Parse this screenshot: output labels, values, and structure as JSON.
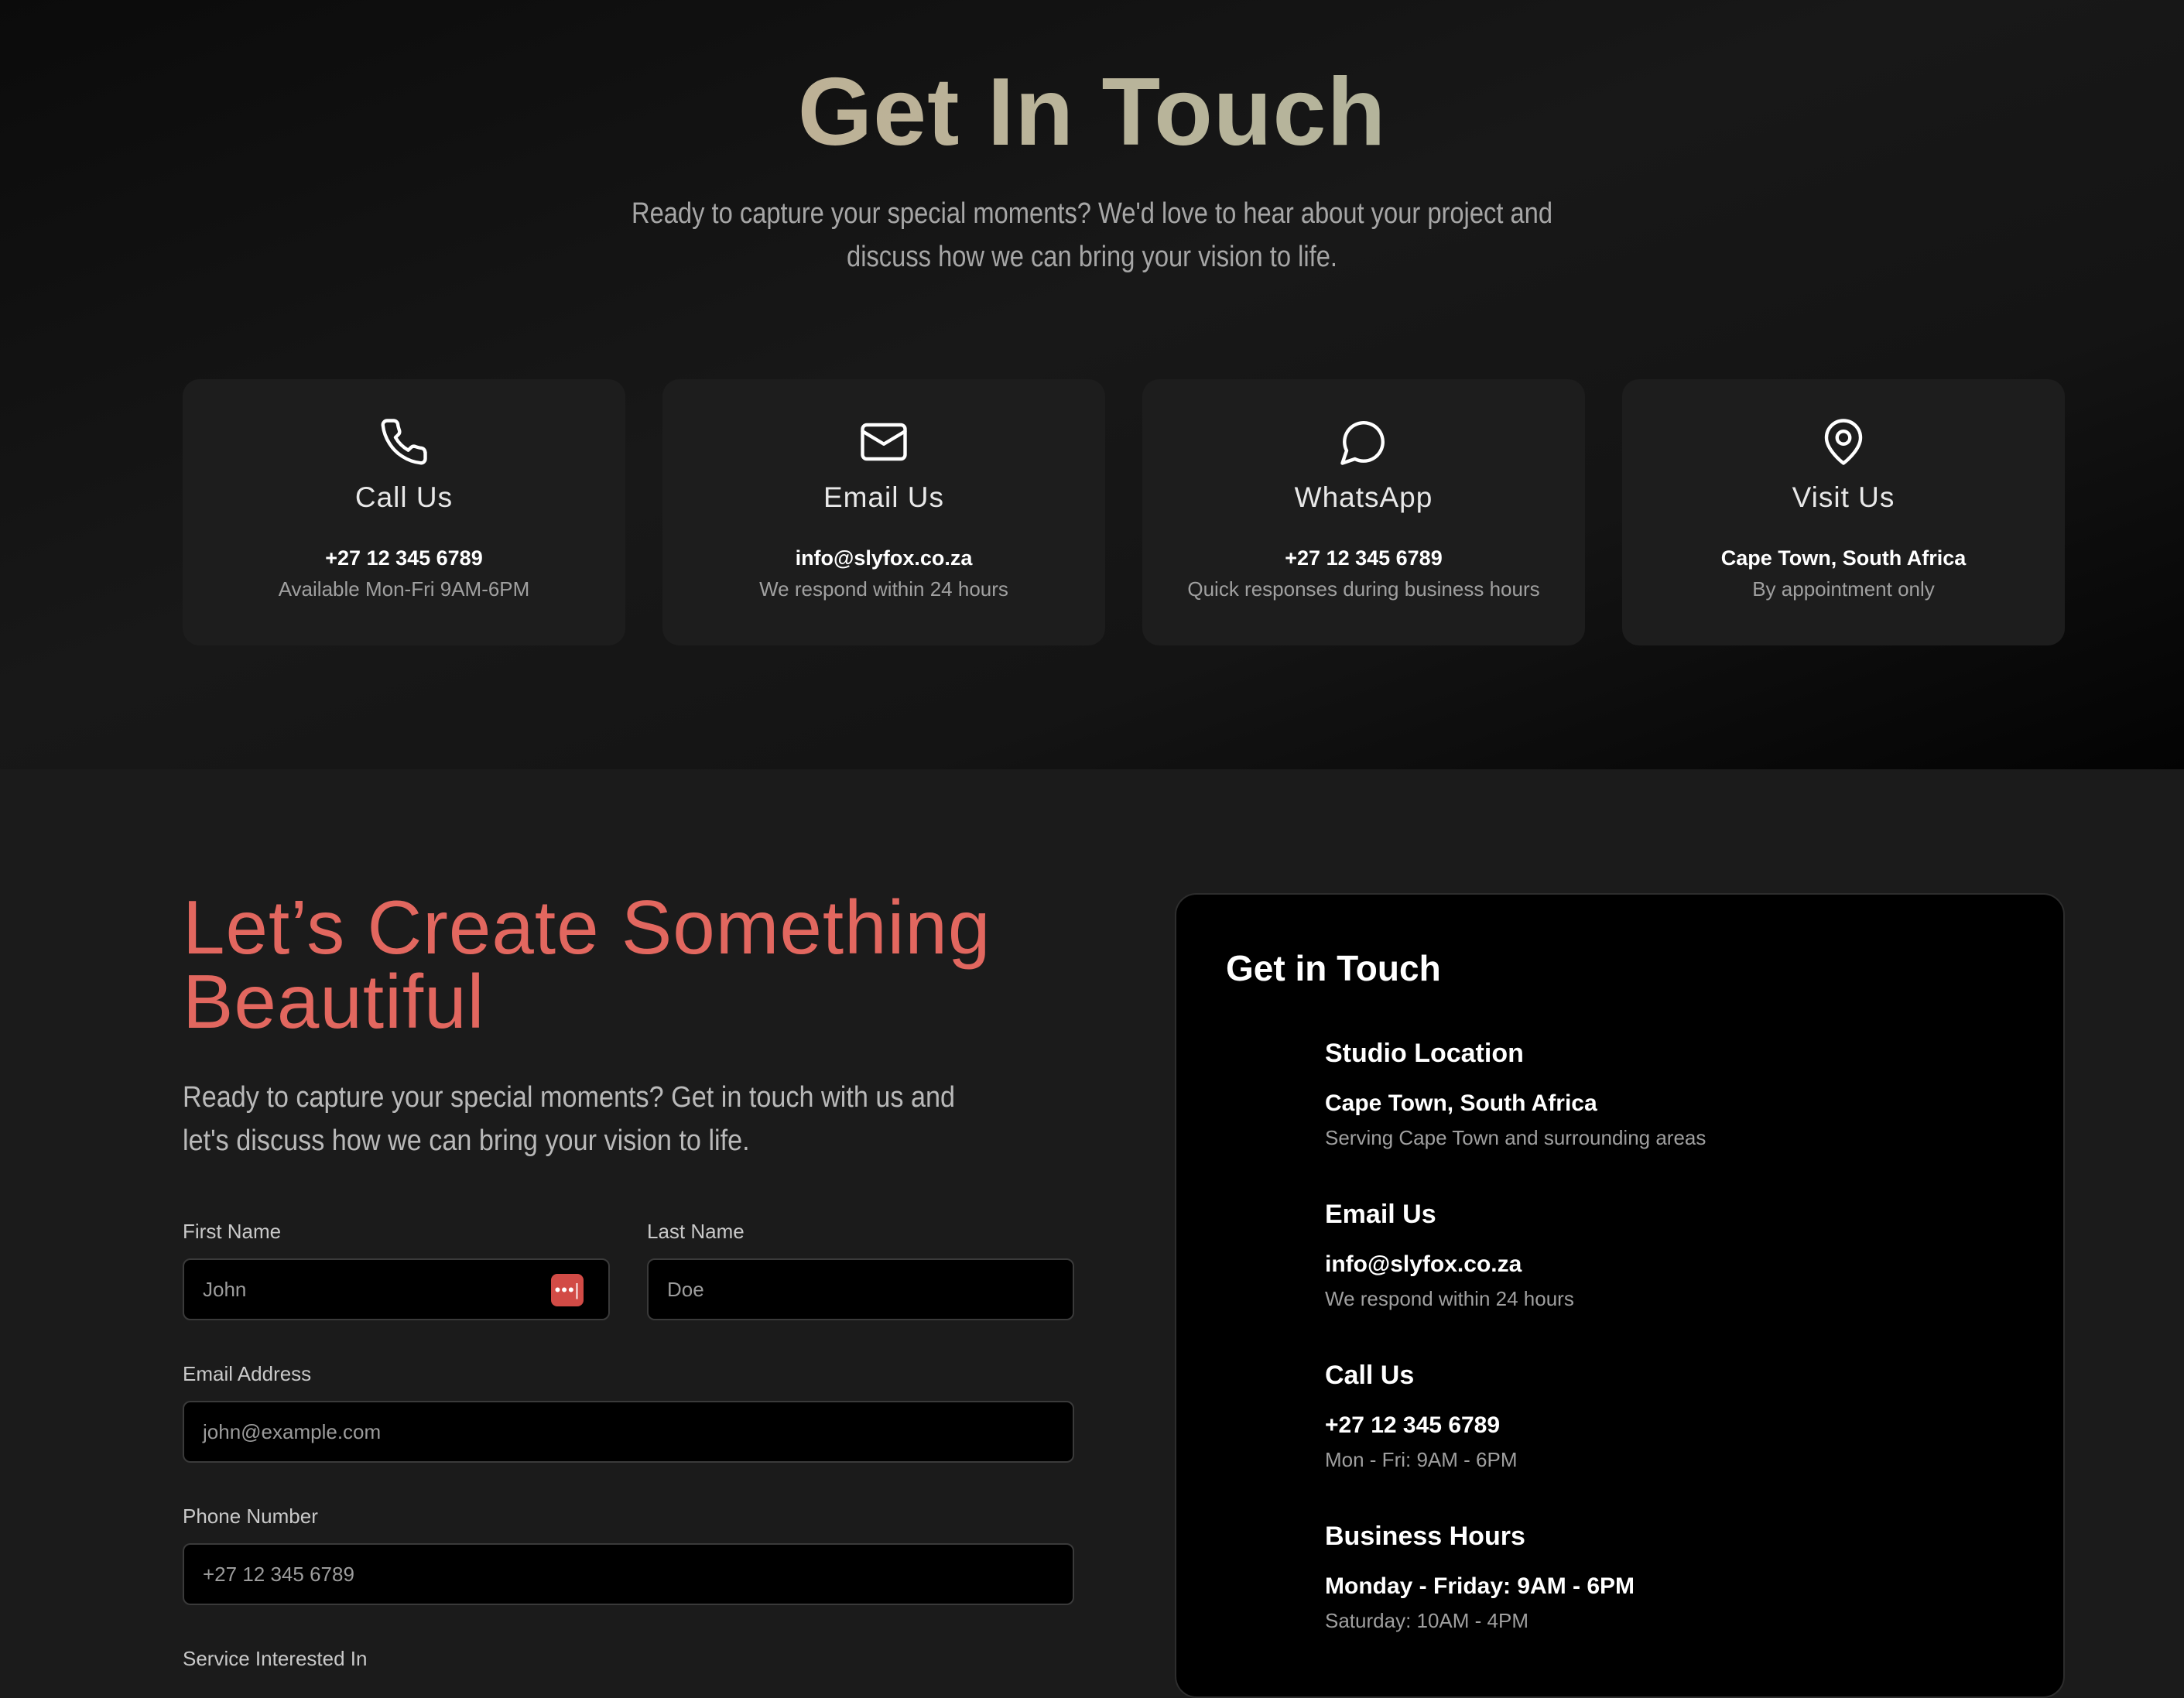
{
  "hero": {
    "title": "Get In Touch",
    "subtitle": "Ready to capture your special moments? We'd love to hear about your project and discuss how we can bring your vision to life."
  },
  "cards": [
    {
      "icon": "phone-icon",
      "title": "Call Us",
      "main": "+27 12 345 6789",
      "note": "Available Mon-Fri 9AM-6PM"
    },
    {
      "icon": "mail-icon",
      "title": "Email Us",
      "main": "info@slyfox.co.za",
      "note": "We respond within 24 hours"
    },
    {
      "icon": "chat-bubble-icon",
      "title": "WhatsApp",
      "main": "+27 12 345 6789",
      "note": "Quick responses during business hours"
    },
    {
      "icon": "map-pin-icon",
      "title": "Visit Us",
      "main": "Cape Town, South Africa",
      "note": "By appointment only"
    }
  ],
  "form_section": {
    "title_line1": "Let’s Create Something",
    "title_line2": "Beautiful",
    "subtitle": "Ready to capture your special moments? Get in touch with us and let's discuss how we can bring your vision to life.",
    "first_name_label": "First Name",
    "first_name_value": "John",
    "last_name_label": "Last Name",
    "last_name_value": "Doe",
    "email_label": "Email Address",
    "email_value": "john@example.com",
    "phone_label": "Phone Number",
    "phone_value": "+27 12 345 6789",
    "service_label": "Service Interested In"
  },
  "panel": {
    "title": "Get in Touch",
    "blocks": [
      {
        "heading": "Studio Location",
        "main": "Cape Town, South Africa",
        "note": "Serving Cape Town and surrounding areas"
      },
      {
        "heading": "Email Us",
        "main": "info@slyfox.co.za",
        "note": "We respond within 24 hours"
      },
      {
        "heading": "Call Us",
        "main": "+27 12 345 6789",
        "note": "Mon - Fri: 9AM - 6PM"
      },
      {
        "heading": "Business Hours",
        "main": "Monday - Friday: 9AM - 6PM",
        "note": "Saturday: 10AM - 4PM"
      }
    ]
  },
  "colors": {
    "accent_coral": "#e2675f",
    "title_gradient_start": "#c8a98c",
    "title_gradient_end": "#a7b59f",
    "password_badge": "#d24b46"
  }
}
